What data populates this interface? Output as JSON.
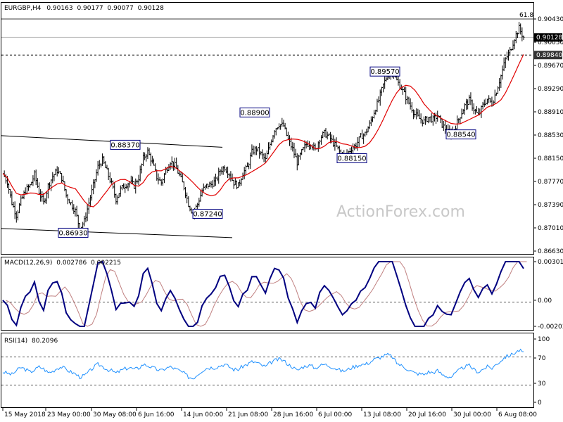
{
  "chart_data": [
    {
      "type": "candlestick",
      "header": {
        "symbol": "EURGBP,H4",
        "open": "0.90163",
        "high": "0.90177",
        "low": "0.90077",
        "close": "0.90128"
      },
      "y_ticks": [
        "0.90430",
        "0.90050",
        "0.89670",
        "0.89290",
        "0.88910",
        "0.88530",
        "0.88150",
        "0.87770",
        "0.87390",
        "0.87010",
        "0.86630"
      ],
      "ylim": [
        0.8663,
        0.9043
      ],
      "price_tags": [
        {
          "label": "0.90128",
          "value": 0.90128,
          "style": "dark"
        },
        {
          "label": "0.89840",
          "value": 0.8984,
          "style": "dashed"
        }
      ],
      "fib_label": "61.8",
      "fib_level": 0.9043,
      "annotations": [
        {
          "label": "0.88370",
          "value": 0.8837
        },
        {
          "label": "0.86930",
          "value": 0.8693
        },
        {
          "label": "0.87240",
          "value": 0.8724
        },
        {
          "label": "0.88900",
          "value": 0.889
        },
        {
          "label": "0.88150",
          "value": 0.8815
        },
        {
          "label": "0.89570",
          "value": 0.8957
        },
        {
          "label": "0.88540",
          "value": 0.8854
        }
      ],
      "close_series": [
        0.879,
        0.8776,
        0.8742,
        0.8722,
        0.8745,
        0.8762,
        0.877,
        0.8788,
        0.876,
        0.8742,
        0.877,
        0.8785,
        0.8795,
        0.8783,
        0.8754,
        0.8741,
        0.8729,
        0.87,
        0.8712,
        0.8742,
        0.877,
        0.8801,
        0.8812,
        0.8793,
        0.8773,
        0.8748,
        0.8764,
        0.8771,
        0.8776,
        0.877,
        0.8783,
        0.8815,
        0.8826,
        0.8808,
        0.8784,
        0.8775,
        0.8795,
        0.881,
        0.8803,
        0.8787,
        0.8768,
        0.874,
        0.8724,
        0.874,
        0.8762,
        0.877,
        0.8772,
        0.8778,
        0.8795,
        0.88,
        0.879,
        0.8775,
        0.877,
        0.8791,
        0.88,
        0.8825,
        0.8831,
        0.8822,
        0.8812,
        0.8838,
        0.8862,
        0.8871,
        0.8868,
        0.8845,
        0.883,
        0.8808,
        0.8825,
        0.8838,
        0.884,
        0.8828,
        0.8848,
        0.8856,
        0.885,
        0.884,
        0.883,
        0.8818,
        0.8822,
        0.8831,
        0.8837,
        0.885,
        0.8855,
        0.887,
        0.8891,
        0.891,
        0.8935,
        0.8952,
        0.8957,
        0.8942,
        0.893,
        0.8915,
        0.8901,
        0.8887,
        0.888,
        0.8875,
        0.8882,
        0.8878,
        0.8885,
        0.887,
        0.886,
        0.8854,
        0.8868,
        0.8885,
        0.8901,
        0.891,
        0.8896,
        0.8885,
        0.8901,
        0.8912,
        0.8905,
        0.8925,
        0.895,
        0.8977,
        0.899,
        0.9012,
        0.9028,
        0.9013
      ],
      "ma_series_name": "",
      "ma_color": "#ff0000",
      "line_color": "#000000",
      "channel_color": "#000000"
    },
    {
      "type": "line",
      "header": {
        "name": "MACD(12,26,9)",
        "v1": "0.002786",
        "v2": "0.002215"
      },
      "y_ticks": [
        "0.003016",
        "0.00",
        "-0.002037"
      ],
      "ylim": [
        -0.002037,
        0.003016
      ],
      "macd_color": "#000080",
      "signal_color": "#c08080"
    },
    {
      "type": "line",
      "header": {
        "name": "RSI(14)",
        "value": "80.2096"
      },
      "y_ticks": [
        "100",
        "70",
        "30",
        "0"
      ],
      "ylim": [
        0,
        100
      ],
      "levels": [
        70,
        30
      ],
      "color": "#1e90ff",
      "series": [
        48,
        46,
        44,
        50,
        55,
        52,
        48,
        51,
        56,
        53,
        47,
        49,
        54,
        56,
        52,
        48,
        45,
        40,
        42,
        48,
        55,
        60,
        57,
        52,
        50,
        46,
        50,
        53,
        55,
        52,
        54,
        60,
        58,
        55,
        52,
        50,
        54,
        56,
        53,
        50,
        46,
        40,
        38,
        44,
        50,
        54,
        55,
        55,
        58,
        60,
        56,
        52,
        52,
        57,
        60,
        64,
        63,
        59,
        56,
        62,
        66,
        68,
        66,
        60,
        56,
        50,
        55,
        58,
        58,
        54,
        58,
        60,
        58,
        55,
        52,
        49,
        51,
        55,
        57,
        60,
        60,
        63,
        68,
        70,
        73,
        75,
        72,
        62,
        58,
        54,
        50,
        46,
        45,
        44,
        48,
        47,
        50,
        44,
        41,
        40,
        46,
        52,
        56,
        58,
        52,
        48,
        52,
        56,
        54,
        60,
        66,
        72,
        74,
        78,
        82,
        80
      ]
    }
  ],
  "x_ticks": [
    "15 May 2018",
    "23 May 00:00",
    "30 May 08:00",
    "6 Jun 16:00",
    "14 Jun 00:00",
    "21 Jun 08:00",
    "28 Jun 16:00",
    "6 Jul 00:00",
    "13 Jul 08:00",
    "20 Jul 16:00",
    "30 Jul 00:00",
    "6 Aug 08:00"
  ],
  "watermark": "ActionForex.com"
}
